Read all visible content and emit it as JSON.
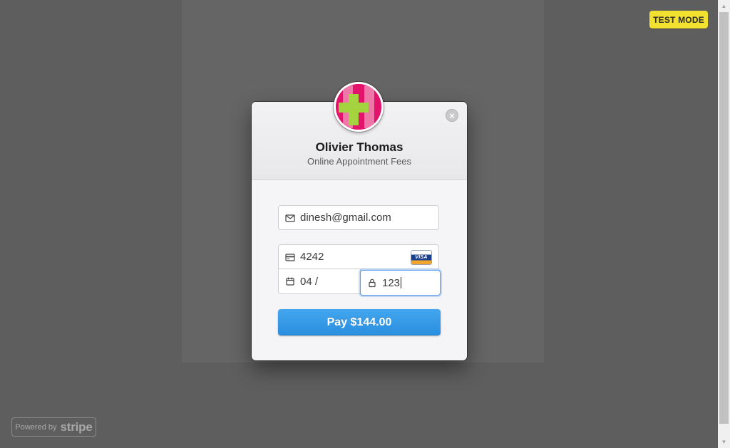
{
  "badge": {
    "test_mode": "TEST MODE"
  },
  "merchant": {
    "name": "Olivier Thomas",
    "description": "Online Appointment Fees",
    "logo_colors": {
      "background": "#e3126b",
      "cross": "#a3d43f"
    }
  },
  "form": {
    "email": {
      "value": "dinesh@gmail.com",
      "icon": "mail-icon"
    },
    "card": {
      "number": "4242",
      "icon": "credit-card-icon",
      "brand": "VISA"
    },
    "expiry": {
      "value": "04 /",
      "icon": "calendar-icon"
    },
    "cvc": {
      "value": "123",
      "icon": "lock-icon"
    }
  },
  "pay_button": {
    "label": "Pay $144.00"
  },
  "footer": {
    "powered_by": "Powered by",
    "brand": "stripe"
  },
  "colors": {
    "accent": "#2a8ee0",
    "test_mode_badge": "#f3e12f",
    "overlay": "#5e5e5e"
  }
}
